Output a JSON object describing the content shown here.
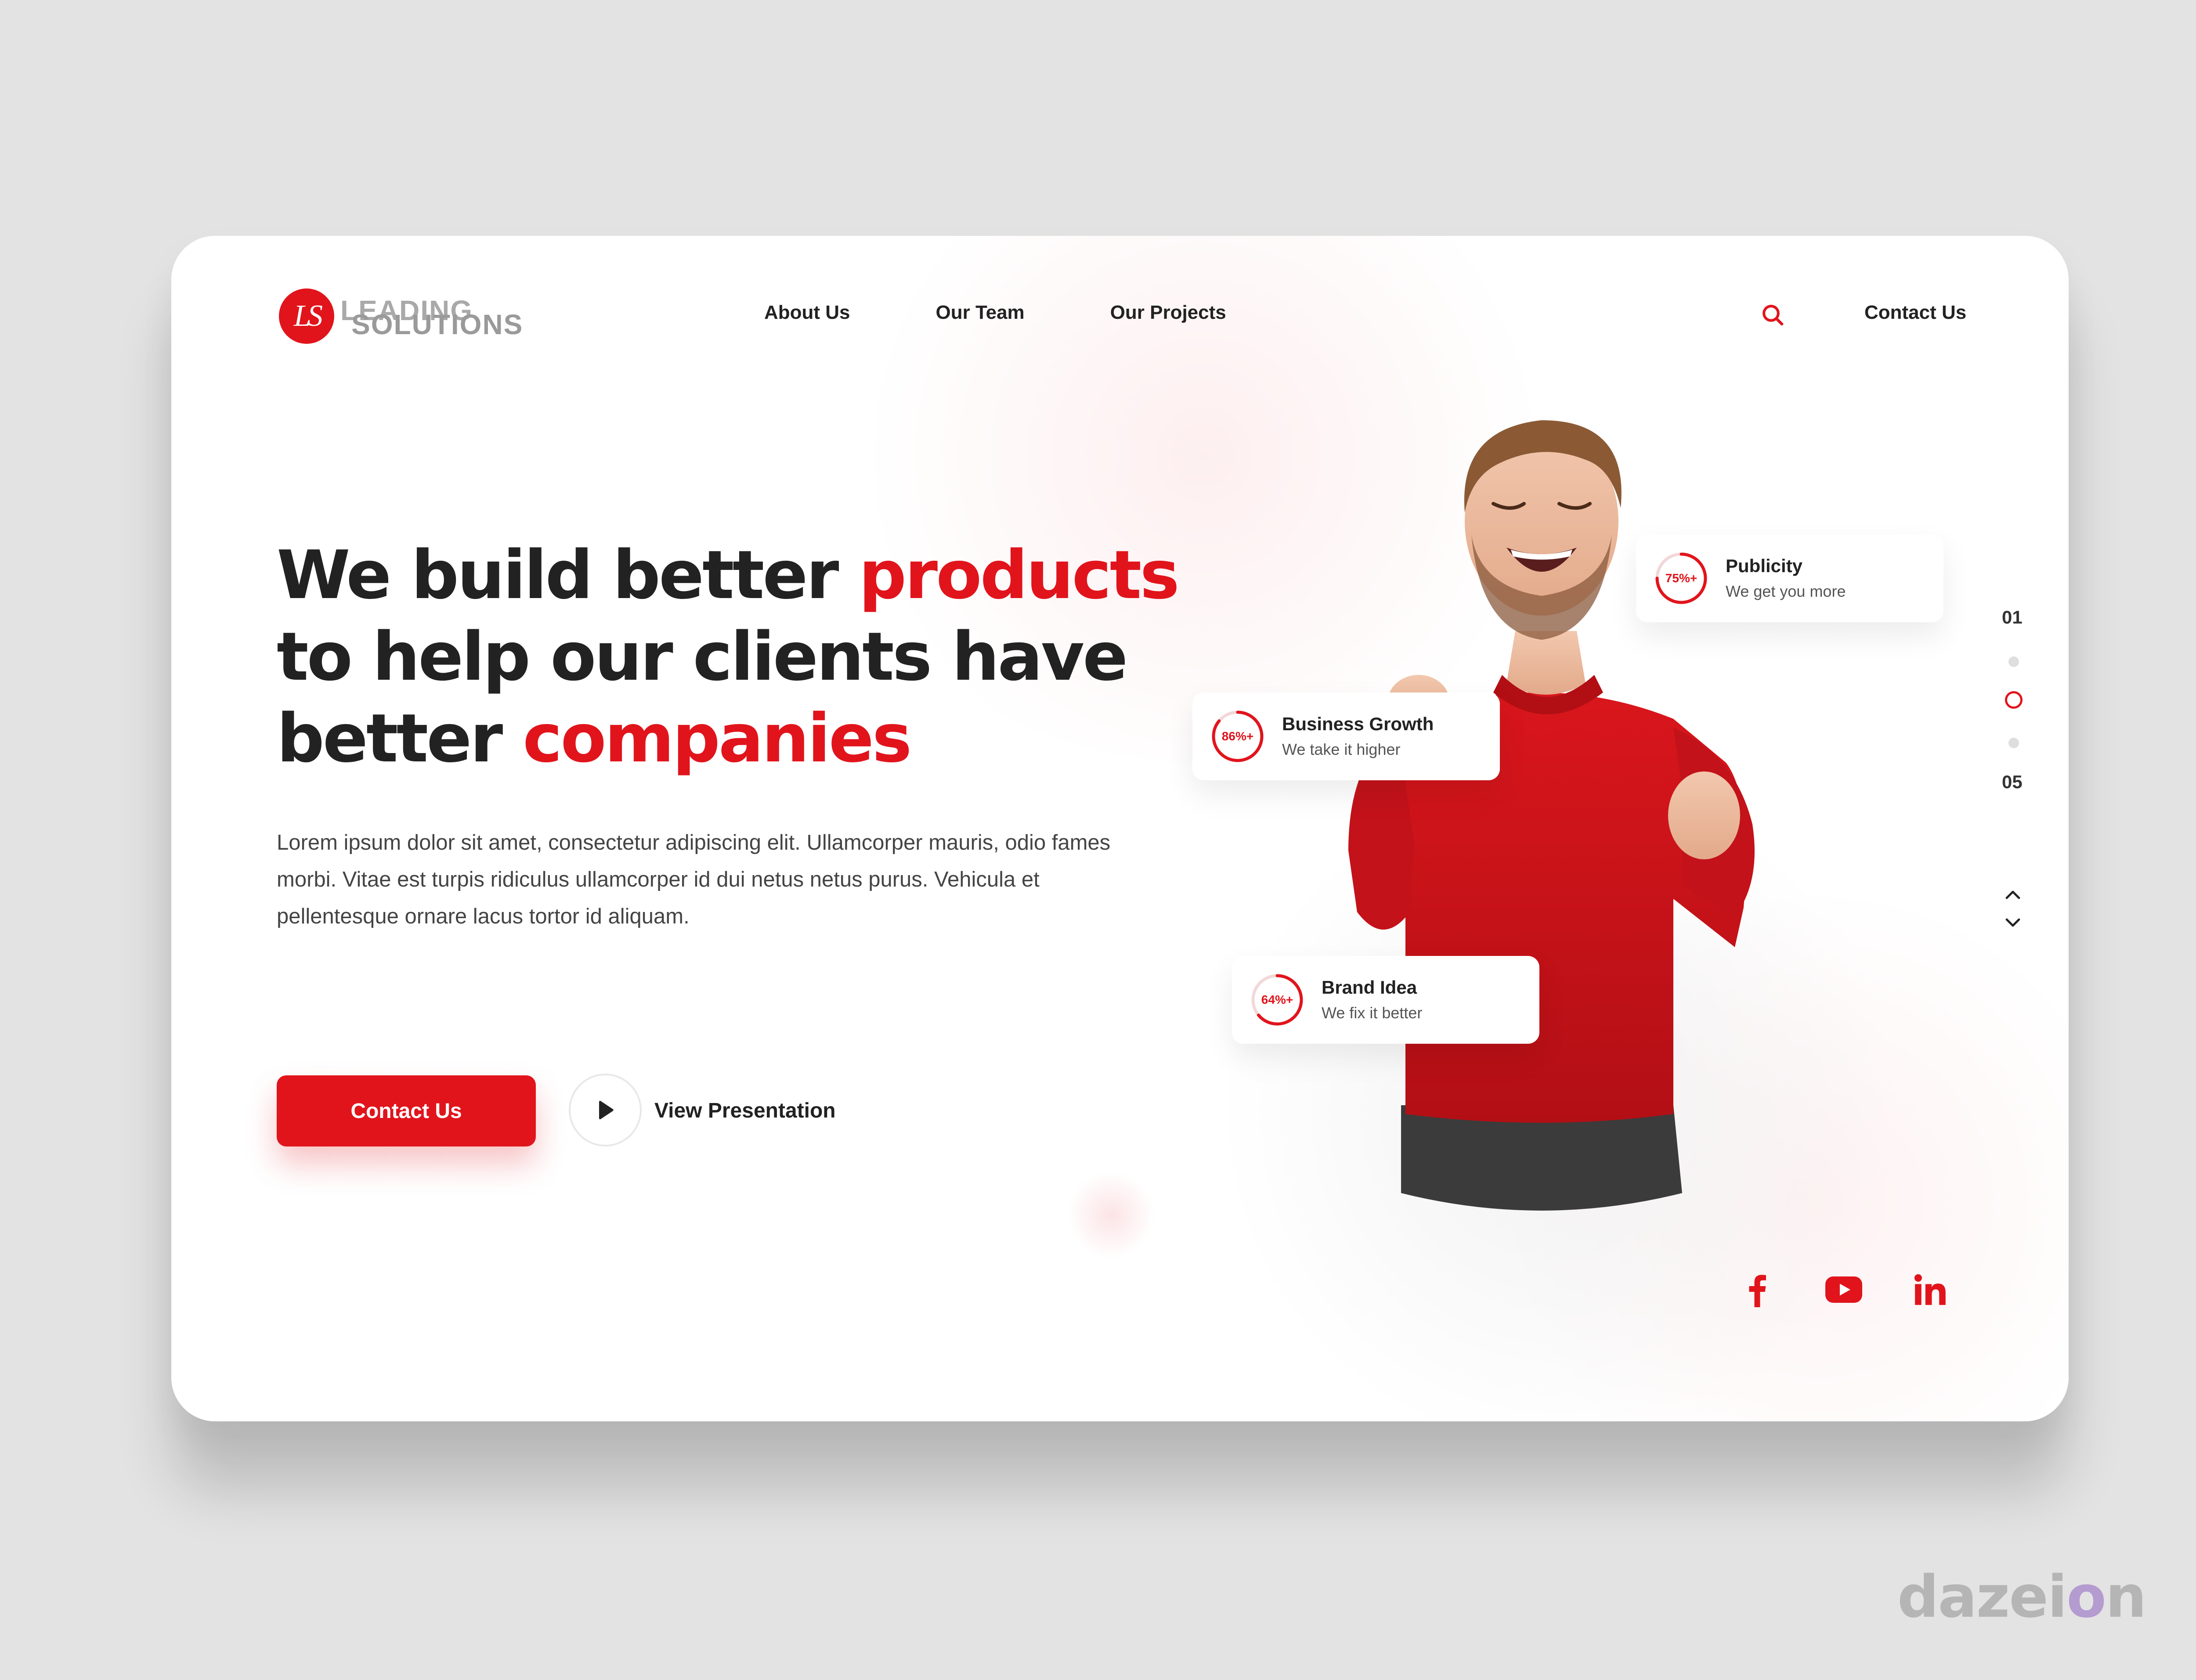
{
  "brand": {
    "mark": "LS",
    "line1": "LEADING",
    "line2": "SOLUTIONS",
    "accent_color": "#e1141c"
  },
  "nav": {
    "items": [
      {
        "label": "About Us"
      },
      {
        "label": "Our Team"
      },
      {
        "label": "Our Projects"
      }
    ],
    "search_icon": "search-icon",
    "contact_label": "Contact Us"
  },
  "hero": {
    "headline": {
      "line1_a": "We build better ",
      "line1_b": "products",
      "line2": "to help our clients have",
      "line3_a": "better ",
      "line3_b": "companies"
    },
    "description": "Lorem ipsum dolor sit amet, consectetur adipiscing elit. Ullamcorper mauris, odio fames morbi. Vitae est turpis ridiculus ullamcorper id dui netus netus purus. Vehicula et pellentesque ornare lacus tortor id aliquam.",
    "cta_label": "Contact Us",
    "presentation_label": "View Presentation"
  },
  "stats": [
    {
      "label": "75%+",
      "value": 0.75,
      "title": "Publicity",
      "subtitle": "We get you more"
    },
    {
      "label": "86%+",
      "value": 0.86,
      "title": "Business Growth",
      "subtitle": "We take it higher"
    },
    {
      "label": "64%+",
      "value": 0.64,
      "title": "Brand Idea",
      "subtitle": "We fix it better"
    }
  ],
  "pager": {
    "first": "01",
    "last": "05",
    "active_index": 2
  },
  "social": [
    {
      "icon": "facebook-icon"
    },
    {
      "icon": "youtube-icon"
    },
    {
      "icon": "linkedin-icon"
    }
  ],
  "watermark": {
    "before": "daze",
    "o": "o",
    "after": "n",
    "i": "i"
  }
}
